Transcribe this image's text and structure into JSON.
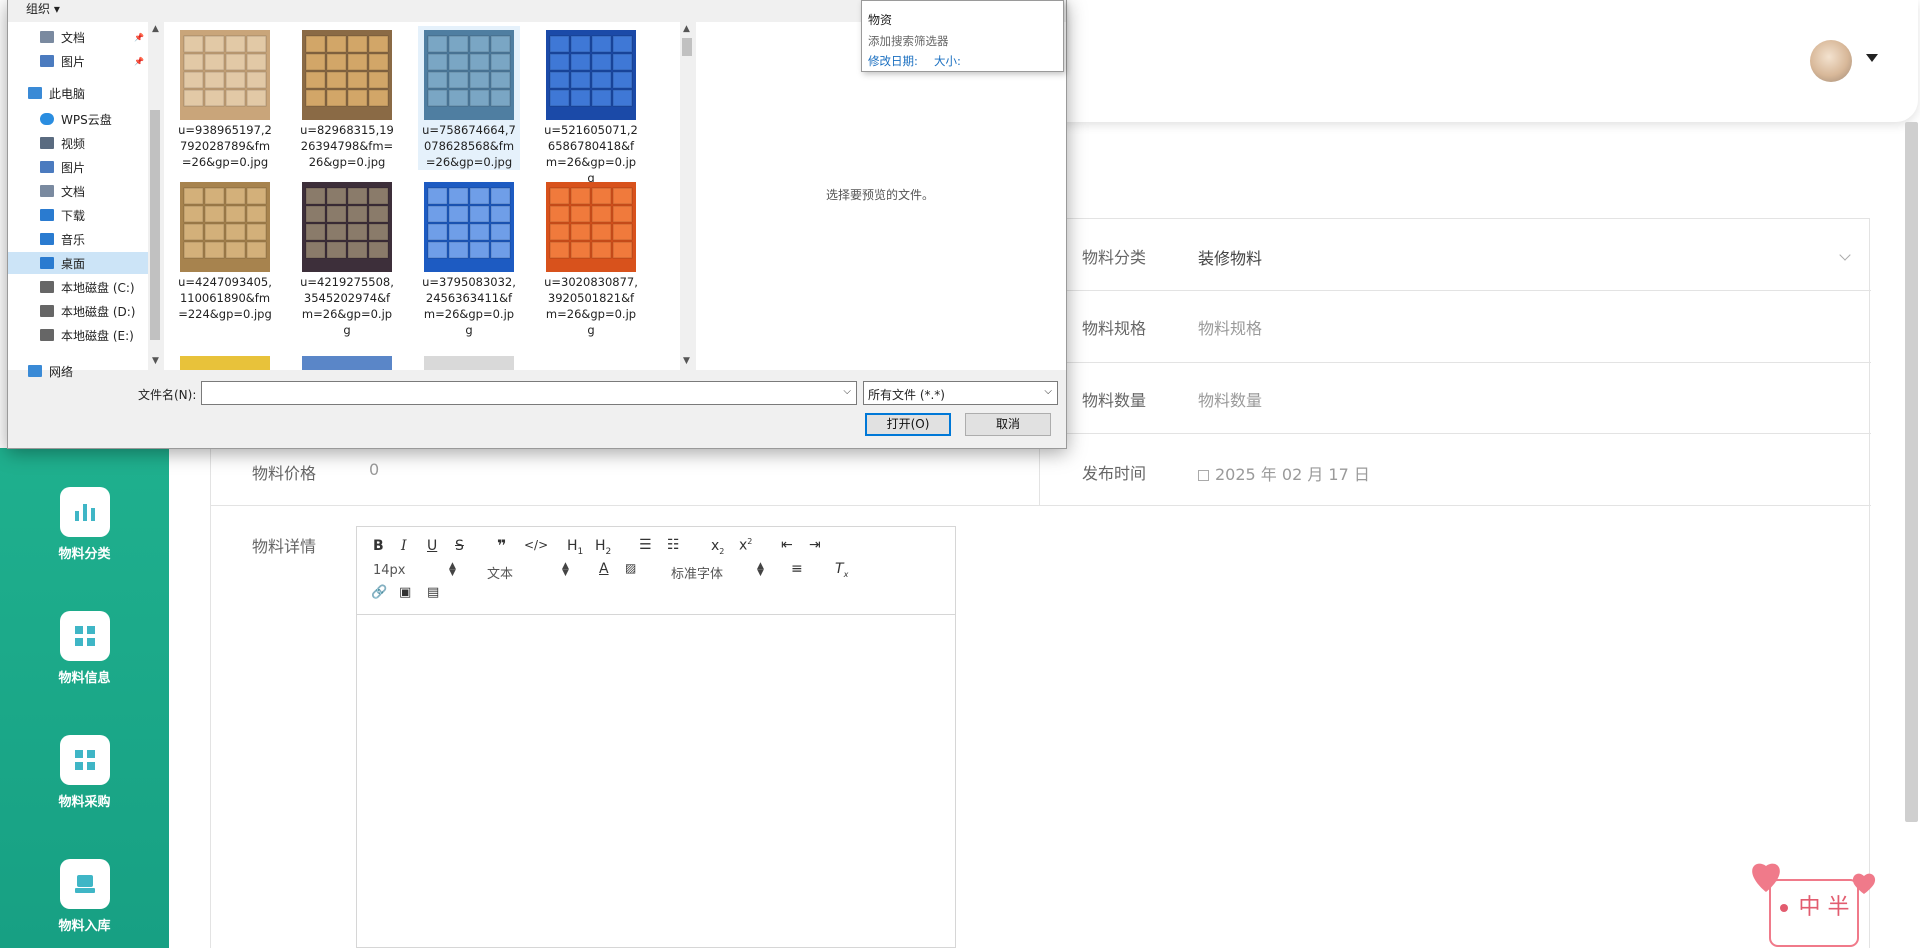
{
  "sidebar": {
    "items": [
      {
        "label": "物料分类",
        "icon": "bar-chart-icon"
      },
      {
        "label": "物料信息",
        "icon": "grid-icon"
      },
      {
        "label": "物料采购",
        "icon": "grid-icon"
      },
      {
        "label": "物料入库",
        "icon": "inbox-icon"
      }
    ]
  },
  "form": {
    "category_label": "物料分类",
    "category_value": "装修物料",
    "spec_label": "物料规格",
    "spec_placeholder": "物料规格",
    "qty_label": "物料数量",
    "qty_placeholder": "物料数量",
    "price_label": "物料价格",
    "price_value": "0",
    "publish_label": "发布时间",
    "publish_value": "2025 年 02 月 17 日",
    "detail_label": "物料详情"
  },
  "editor": {
    "font_size": "14px",
    "text_type": "文本",
    "font_family": "标准字体"
  },
  "stamp": {
    "text": "中 半"
  },
  "dialog": {
    "organize": "组织",
    "nav_items": [
      {
        "label": "文档",
        "icon": "document-icon",
        "level": 1,
        "pinned": true
      },
      {
        "label": "图片",
        "icon": "picture-icon",
        "level": 1,
        "pinned": true
      },
      {
        "label": "此电脑",
        "icon": "computer-icon",
        "level": 0
      },
      {
        "label": "WPS云盘",
        "icon": "cloud-icon",
        "level": 1
      },
      {
        "label": "视频",
        "icon": "video-icon",
        "level": 1
      },
      {
        "label": "图片",
        "icon": "picture-icon",
        "level": 1
      },
      {
        "label": "文档",
        "icon": "document-icon",
        "level": 1
      },
      {
        "label": "下载",
        "icon": "download-icon",
        "level": 1
      },
      {
        "label": "音乐",
        "icon": "music-icon",
        "level": 1
      },
      {
        "label": "桌面",
        "icon": "desktop-icon",
        "level": 1,
        "selected": true
      },
      {
        "label": "本地磁盘 (C:)",
        "icon": "drive-icon",
        "level": 1
      },
      {
        "label": "本地磁盘 (D:)",
        "icon": "drive-icon",
        "level": 1
      },
      {
        "label": "本地磁盘 (E:)",
        "icon": "drive-icon",
        "level": 1
      },
      {
        "label": "网络",
        "icon": "network-icon",
        "level": 0
      }
    ],
    "files": [
      {
        "name": "u=938965197,2792028789&fm=26&gp=0.jpg",
        "color": "#c9a57a",
        "accent": "#e2c9a6"
      },
      {
        "name": "u=82968315,1926394798&fm=26&gp=0.jpg",
        "color": "#8a6a45",
        "accent": "#d2a668"
      },
      {
        "name": "u=758674664,7078628568&fm=26&gp=0.jpg",
        "color": "#4f7ea1",
        "accent": "#7aa6c4",
        "selected": true
      },
      {
        "name": "u=521605071,26586780418&fm=26&gp=0.jpg",
        "color": "#1b4aa8",
        "accent": "#3f78d6"
      },
      {
        "name": "u=4247093405,110061890&fm=224&gp=0.jpg",
        "color": "#a7834e",
        "accent": "#d3b07a"
      },
      {
        "name": "u=4219275508,3545202974&fm=26&gp=0.jpg",
        "color": "#3d2f3a",
        "accent": "#8a7b6a"
      },
      {
        "name": "u=3795083032,2456363411&fm=26&gp=0.jpg",
        "color": "#1d5bc2",
        "accent": "#6f9ee8"
      },
      {
        "name": "u=3020830877,3920501821&fm=26&gp=0.jpg",
        "color": "#d8521c",
        "accent": "#f07a3c"
      }
    ],
    "preview_text": "选择要预览的文件。",
    "filename_label": "文件名(N):",
    "filename_value": "",
    "filetype": "所有文件 (*.*)",
    "open_button": "打开(O)",
    "cancel_button": "取消",
    "search_popup": {
      "item": "物资",
      "hint": "添加搜索筛选器",
      "link_date": "修改日期:",
      "link_size": "大小:"
    }
  }
}
